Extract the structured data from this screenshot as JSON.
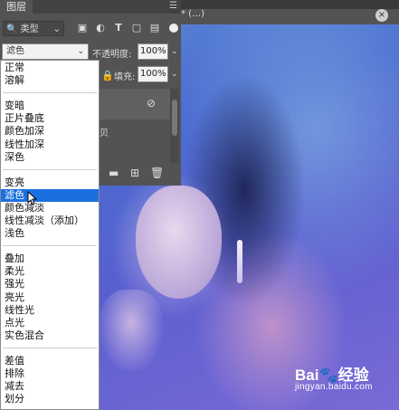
{
  "document": {
    "tab_text": "* (…)",
    "watermark": {
      "logo": "Baiđ! 经验",
      "url": "jingyan.baidu.com"
    }
  },
  "layers_panel": {
    "tab_label": "图层",
    "filter_label": "类型",
    "filter_icons": [
      "image-icon",
      "adjustment-icon",
      "text-icon",
      "shape-icon",
      "smart-object-icon"
    ],
    "blend_mode": "滤色",
    "opacity_label": "不透明度:",
    "opacity_value": "100%",
    "fill_label": "填充:",
    "fill_value": "100%",
    "layer_name_fragment": "贝"
  },
  "blend_menu": {
    "items": [
      "正常",
      "溶解",
      "变暗",
      "正片叠底",
      "颜色加深",
      "线性加深",
      "深色",
      "变亮",
      "滤色",
      "颜色减淡",
      "线性减淡（添加）",
      "浅色",
      "叠加",
      "柔光",
      "强光",
      "亮光",
      "线性光",
      "点光",
      "实色混合",
      "差值",
      "排除",
      "减去",
      "划分"
    ],
    "selected": "滤色"
  },
  "colors": {
    "menu_highlight": "#1c6fe0",
    "panel_bg": "#535353"
  }
}
